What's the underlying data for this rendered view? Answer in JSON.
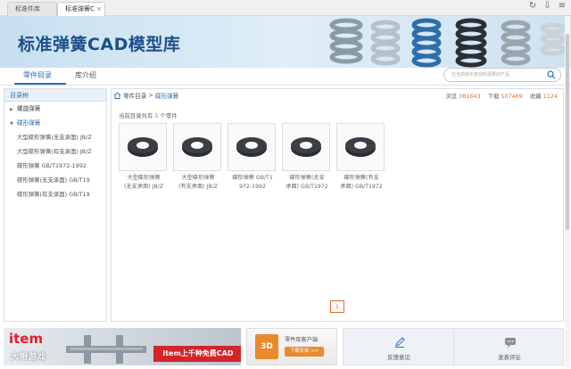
{
  "tabs": [
    {
      "label": "标准件库"
    },
    {
      "label": "标准弹簧C"
    }
  ],
  "banner": {
    "title": "标准弹簧CAD模型库"
  },
  "nav": {
    "tabs": [
      {
        "label": "零件目录"
      },
      {
        "label": "库介绍"
      }
    ],
    "search_placeholder": "在当前库中查找所需要的产品"
  },
  "sidebar": {
    "header": "目录树",
    "groups": [
      {
        "label": "螺旋弹簧",
        "open": false
      },
      {
        "label": "碟形弹簧",
        "open": true
      }
    ],
    "items": [
      {
        "label": "大型碟形弹簧(无支承面) JB/Z"
      },
      {
        "label": "大型碟形弹簧(有支承面) JB/Z"
      },
      {
        "label": "碟形弹簧 GB/T1972-1992"
      },
      {
        "label": "碟形弹簧(无支承面) GB/T19"
      },
      {
        "label": "碟形弹簧(有支承面) GB/T19"
      }
    ]
  },
  "main": {
    "breadcrumb": {
      "root": "零件目录",
      "sep": ">",
      "current": "碟形弹簧"
    },
    "stats": {
      "views_label": "浏览",
      "views": "381643",
      "downloads_label": "下载",
      "downloads": "107469",
      "favorites_label": "收藏",
      "favorites": "1124"
    },
    "total": {
      "prefix": "当前目录共有",
      "count": "5",
      "suffix": "个零件"
    },
    "parts": [
      {
        "line1": "大型碟形弹簧",
        "line2": "(无支承面) JB/Z"
      },
      {
        "line1": "大型碟形弹簧",
        "line2": "(有支承面) JB/Z"
      },
      {
        "line1": "碟形弹簧 GB/T1",
        "line2": "972-1992"
      },
      {
        "line1": "碟形弹簧(无支",
        "line2": "承面) GB/T1972"
      },
      {
        "line1": "碟形弹簧(有支",
        "line2": "承面) GB/T1972"
      }
    ],
    "page": "1"
  },
  "ads": {
    "ad1": {
      "brand": "item",
      "cta": "item上千种免费CAD",
      "watermark": "大眼游戏"
    },
    "ad2": {
      "badge": "3D",
      "title": "零件库客户端",
      "button": "下载安装 >>"
    }
  },
  "feedback": {
    "label": "反馈意见"
  },
  "comment": {
    "label": "发表评论"
  }
}
